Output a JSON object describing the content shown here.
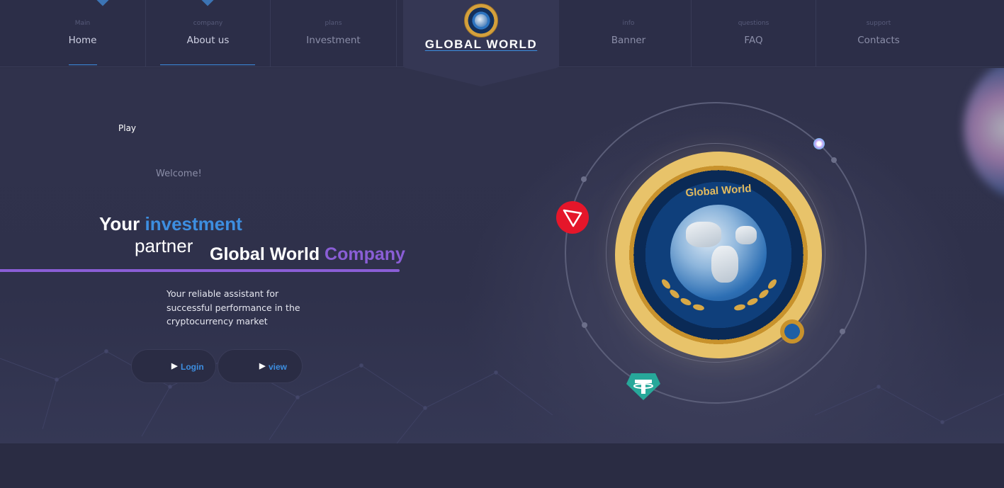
{
  "nav": {
    "items": [
      {
        "pre": "Main",
        "label": "Home"
      },
      {
        "pre": "company",
        "label": "About us"
      },
      {
        "pre": "plans",
        "label": "Investment"
      },
      {
        "pre": "info",
        "label": "Banner"
      },
      {
        "pre": "questions",
        "label": "FAQ"
      },
      {
        "pre": "support",
        "label": "Contacts"
      }
    ],
    "active": "About us"
  },
  "logo": {
    "text": "GLOBAL WORLD"
  },
  "hero": {
    "play_label": "Play",
    "welcome": "Welcome!",
    "headline_your": "Your",
    "headline_investment": "investment",
    "headline_partner": "partner",
    "headline_global_world": "Global World",
    "headline_company": "Company",
    "description": "Your reliable assistant for successful performance in the cryptocurrency market",
    "login_label": "Login",
    "view_label": "view",
    "button_icon": "play-arrow-icon"
  },
  "coin": {
    "ring_text": "Global World",
    "icons": [
      "globe-icon",
      "tron-icon",
      "tether-icon",
      "laurel-icon"
    ]
  },
  "colors": {
    "accent_blue": "#3d8ee0",
    "accent_purple": "#8a5ed6",
    "background": "#2b2d44",
    "gold": "#d4a03c"
  }
}
